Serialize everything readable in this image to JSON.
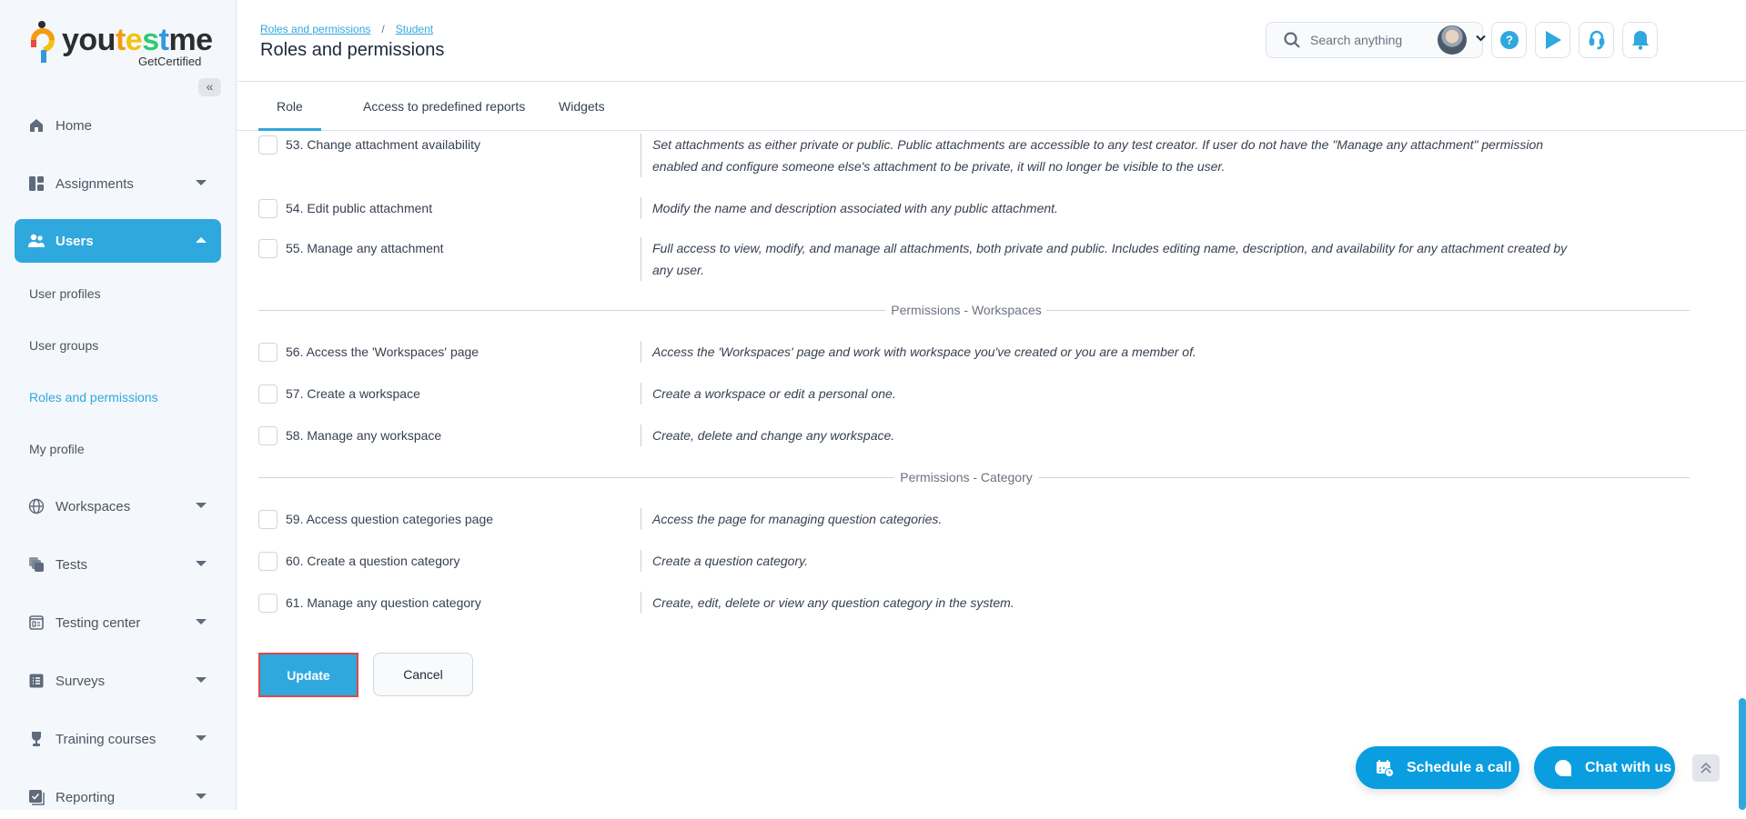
{
  "app": {
    "logo_word": [
      "you",
      "t",
      "e",
      "s",
      "t",
      "me"
    ],
    "logo_sub": "GetCertified",
    "brand_color": "#2fa8de"
  },
  "sidebar": {
    "collapse_icon": "double-chevron-left-icon",
    "items": [
      {
        "label": "Home",
        "icon": "home-icon",
        "expandable": false
      },
      {
        "label": "Assignments",
        "icon": "assignments-icon",
        "expandable": true
      },
      {
        "label": "Users",
        "icon": "users-icon",
        "expandable": true,
        "active": true
      },
      {
        "label": "Workspaces",
        "icon": "globe-icon",
        "expandable": true
      },
      {
        "label": "Tests",
        "icon": "tests-icon",
        "expandable": true
      },
      {
        "label": "Testing center",
        "icon": "testing-center-icon",
        "expandable": true
      },
      {
        "label": "Surveys",
        "icon": "surveys-icon",
        "expandable": true
      },
      {
        "label": "Training courses",
        "icon": "trophy-icon",
        "expandable": true
      },
      {
        "label": "Reporting",
        "icon": "reporting-icon",
        "expandable": true
      }
    ],
    "users_sub": [
      {
        "label": "User profiles"
      },
      {
        "label": "User groups"
      },
      {
        "label": "Roles and permissions",
        "current": true
      },
      {
        "label": "My profile"
      }
    ]
  },
  "header": {
    "breadcrumb": [
      "Roles and permissions",
      "Student"
    ],
    "breadcrumb_sep": "/",
    "title": "Roles and permissions",
    "search_placeholder": "Search anything",
    "icons": [
      "help-icon",
      "play-icon",
      "headset-icon",
      "bell-icon"
    ]
  },
  "tabs": [
    {
      "label": "Role",
      "active": true
    },
    {
      "label": "Access to predefined reports"
    },
    {
      "label": "Widgets"
    }
  ],
  "permissions": [
    {
      "name": "53. Change attachment availability",
      "checked": false,
      "desc": "Set attachments as either private or public. Public attachments are accessible to any test creator. If user do not have the \"Manage any attachment\" permission enabled and configure someone else's attachment to be private, it will no longer be visible to the user."
    },
    {
      "name": "54. Edit public attachment",
      "checked": false,
      "desc": "Modify the name and description associated with any public attachment."
    },
    {
      "name": "55. Manage any attachment",
      "checked": false,
      "desc": "Full access to view, modify, and manage all attachments, both private and public. Includes editing name, description, and availability for any attachment created by any user."
    },
    {
      "name": "56. Access the 'Workspaces' page",
      "checked": false,
      "desc": "Access the 'Workspaces' page and work with workspace you've created or you are a member of."
    },
    {
      "name": "57. Create a workspace",
      "checked": false,
      "desc": "Create a workspace or edit a personal one."
    },
    {
      "name": "58. Manage any workspace",
      "checked": false,
      "desc": "Create, delete and change any workspace."
    },
    {
      "name": "59. Access question categories page",
      "checked": false,
      "desc": "Access the page for managing question categories."
    },
    {
      "name": "60. Create a question category",
      "checked": false,
      "desc": "Create a question category."
    },
    {
      "name": "61. Manage any question category",
      "checked": false,
      "desc": "Create, edit, delete or view any question category in the system."
    }
  ],
  "sections": [
    {
      "label": "Permissions - Workspaces"
    },
    {
      "label": "Permissions - Category"
    }
  ],
  "actions": {
    "update_label": "Update",
    "cancel_label": "Cancel"
  },
  "floating": {
    "schedule_label": "Schedule a call",
    "chat_label": "Chat with us"
  }
}
